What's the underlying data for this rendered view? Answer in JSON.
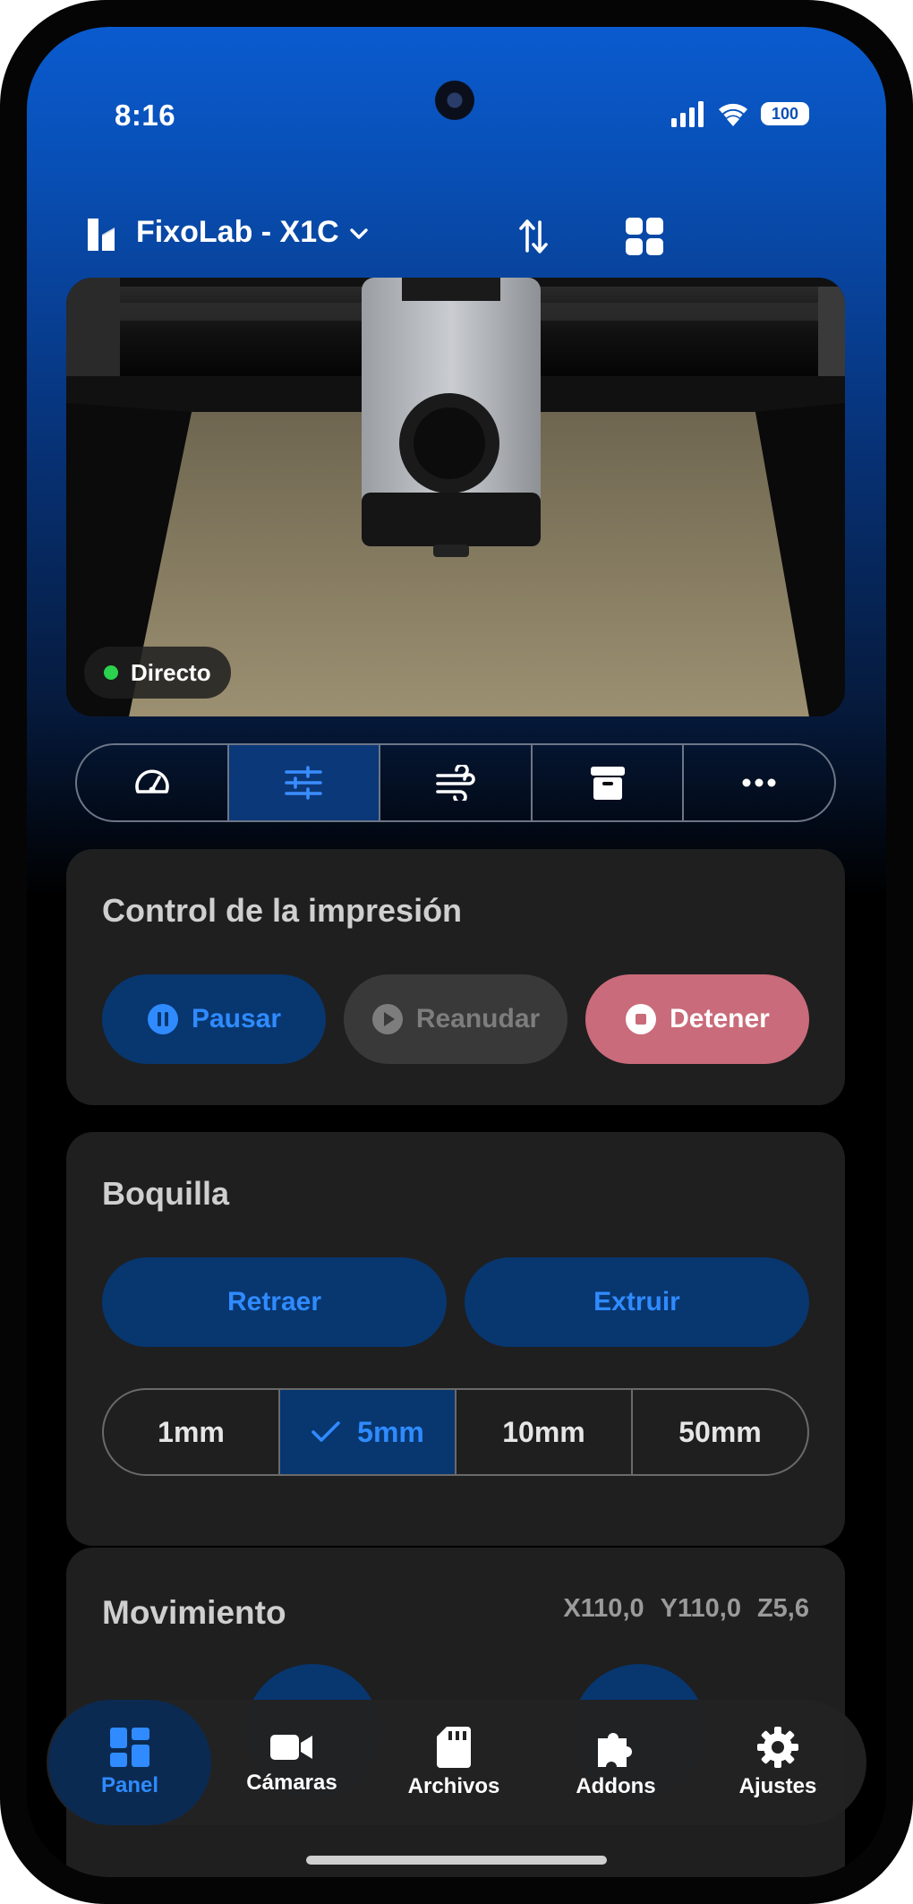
{
  "status_bar": {
    "time": "8:16",
    "battery": "100"
  },
  "header": {
    "printer_name": "FixoLab - X1C"
  },
  "camera": {
    "live_label": "Directo",
    "live_dot_color": "#2bd24e"
  },
  "tabs": [
    {
      "icon": "speedometer-icon",
      "active": false
    },
    {
      "icon": "sliders-icon",
      "active": true
    },
    {
      "icon": "fan-wind-icon",
      "active": false
    },
    {
      "icon": "archive-box-icon",
      "active": false
    },
    {
      "icon": "more-horizontal-icon",
      "active": false
    }
  ],
  "print_control": {
    "title": "Control de la impresión",
    "pause_label": "Pausar",
    "resume_label": "Reanudar",
    "stop_label": "Detener"
  },
  "nozzle": {
    "title": "Boquilla",
    "retract_label": "Retraer",
    "extrude_label": "Extruir",
    "distances": [
      "1mm",
      "5mm",
      "10mm",
      "50mm"
    ],
    "selected": "5mm"
  },
  "movement": {
    "title": "Movimiento",
    "x": "X110,0",
    "y": "Y110,0",
    "z": "Z5,6"
  },
  "bottom_nav": [
    {
      "label": "Panel",
      "icon": "dashboard-icon",
      "active": true
    },
    {
      "label": "Cámaras",
      "icon": "video-camera-icon",
      "active": false
    },
    {
      "label": "Archivos",
      "icon": "sd-card-icon",
      "active": false
    },
    {
      "label": "Addons",
      "icon": "puzzle-icon",
      "active": false
    },
    {
      "label": "Ajustes",
      "icon": "gear-icon",
      "active": false
    }
  ],
  "colors": {
    "accent": "#2f8bff",
    "accent_bg": "#08366f",
    "stop": "#c96b7a",
    "card": "#1f1f1f"
  }
}
